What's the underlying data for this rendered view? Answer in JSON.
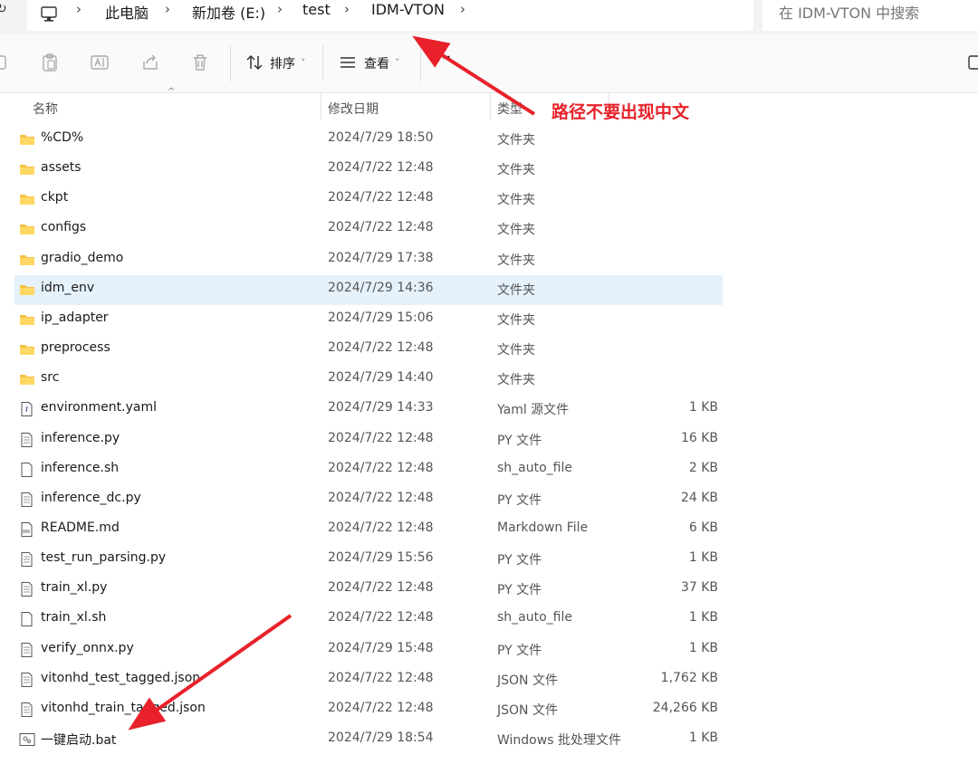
{
  "address": {
    "refresh_glyph": "↻",
    "breadcrumbs": [
      "此电脑",
      "新加卷 (E:)",
      "test",
      "IDM-VTON"
    ],
    "separator": "›",
    "search_placeholder": "在 IDM-VTON 中搜索"
  },
  "toolbar": {
    "sort_label": "排序",
    "view_label": "查看",
    "more_label": "···",
    "dropdown_glyph": "˅",
    "icons": [
      "copy-icon",
      "paste-icon",
      "rename-icon",
      "share-icon",
      "delete-icon",
      "sort-icon",
      "view-icon",
      "more-icon"
    ]
  },
  "columns": {
    "name": "名称",
    "date": "修改日期",
    "type": "类型",
    "size": ""
  },
  "annotation": "路径不要出现中文",
  "colors": {
    "folder": "#f5c244",
    "selected_row": "#e5f1fb",
    "annotation": "#e8212a"
  },
  "files": [
    {
      "name": "%CD%",
      "date": "2024/7/29 18:50",
      "type": "文件夹",
      "size": "",
      "icon": "folder-icon"
    },
    {
      "name": "assets",
      "date": "2024/7/22 12:48",
      "type": "文件夹",
      "size": "",
      "icon": "folder-icon"
    },
    {
      "name": "ckpt",
      "date": "2024/7/22 12:48",
      "type": "文件夹",
      "size": "",
      "icon": "folder-icon"
    },
    {
      "name": "configs",
      "date": "2024/7/22 12:48",
      "type": "文件夹",
      "size": "",
      "icon": "folder-icon"
    },
    {
      "name": "gradio_demo",
      "date": "2024/7/29 17:38",
      "type": "文件夹",
      "size": "",
      "icon": "folder-icon"
    },
    {
      "name": "idm_env",
      "date": "2024/7/29 14:36",
      "type": "文件夹",
      "size": "",
      "icon": "folder-icon",
      "selected": true
    },
    {
      "name": "ip_adapter",
      "date": "2024/7/29 15:06",
      "type": "文件夹",
      "size": "",
      "icon": "folder-icon"
    },
    {
      "name": "preprocess",
      "date": "2024/7/22 12:48",
      "type": "文件夹",
      "size": "",
      "icon": "folder-icon"
    },
    {
      "name": "src",
      "date": "2024/7/29 14:40",
      "type": "文件夹",
      "size": "",
      "icon": "folder-icon"
    },
    {
      "name": "environment.yaml",
      "date": "2024/7/29 14:33",
      "type": "Yaml 源文件",
      "size": "1 KB",
      "icon": "yaml-file-icon"
    },
    {
      "name": "inference.py",
      "date": "2024/7/22 12:48",
      "type": "PY 文件",
      "size": "16 KB",
      "icon": "text-file-icon"
    },
    {
      "name": "inference.sh",
      "date": "2024/7/22 12:48",
      "type": "sh_auto_file",
      "size": "2 KB",
      "icon": "blank-file-icon"
    },
    {
      "name": "inference_dc.py",
      "date": "2024/7/22 12:48",
      "type": "PY 文件",
      "size": "24 KB",
      "icon": "text-file-icon"
    },
    {
      "name": "README.md",
      "date": "2024/7/22 12:48",
      "type": "Markdown File",
      "size": "6 KB",
      "icon": "markdown-file-icon"
    },
    {
      "name": "test_run_parsing.py",
      "date": "2024/7/29 15:56",
      "type": "PY 文件",
      "size": "1 KB",
      "icon": "text-file-icon"
    },
    {
      "name": "train_xl.py",
      "date": "2024/7/22 12:48",
      "type": "PY 文件",
      "size": "37 KB",
      "icon": "text-file-icon"
    },
    {
      "name": "train_xl.sh",
      "date": "2024/7/22 12:48",
      "type": "sh_auto_file",
      "size": "1 KB",
      "icon": "blank-file-icon"
    },
    {
      "name": "verify_onnx.py",
      "date": "2024/7/29 15:48",
      "type": "PY 文件",
      "size": "1 KB",
      "icon": "text-file-icon"
    },
    {
      "name": "vitonhd_test_tagged.json",
      "date": "2024/7/22 12:48",
      "type": "JSON 文件",
      "size": "1,762 KB",
      "icon": "text-file-icon"
    },
    {
      "name": "vitonhd_train_tagged.json",
      "date": "2024/7/22 12:48",
      "type": "JSON 文件",
      "size": "24,266 KB",
      "icon": "text-file-icon"
    },
    {
      "name": "一键启动.bat",
      "date": "2024/7/29 18:54",
      "type": "Windows 批处理文件",
      "size": "1 KB",
      "icon": "batch-file-icon"
    }
  ]
}
